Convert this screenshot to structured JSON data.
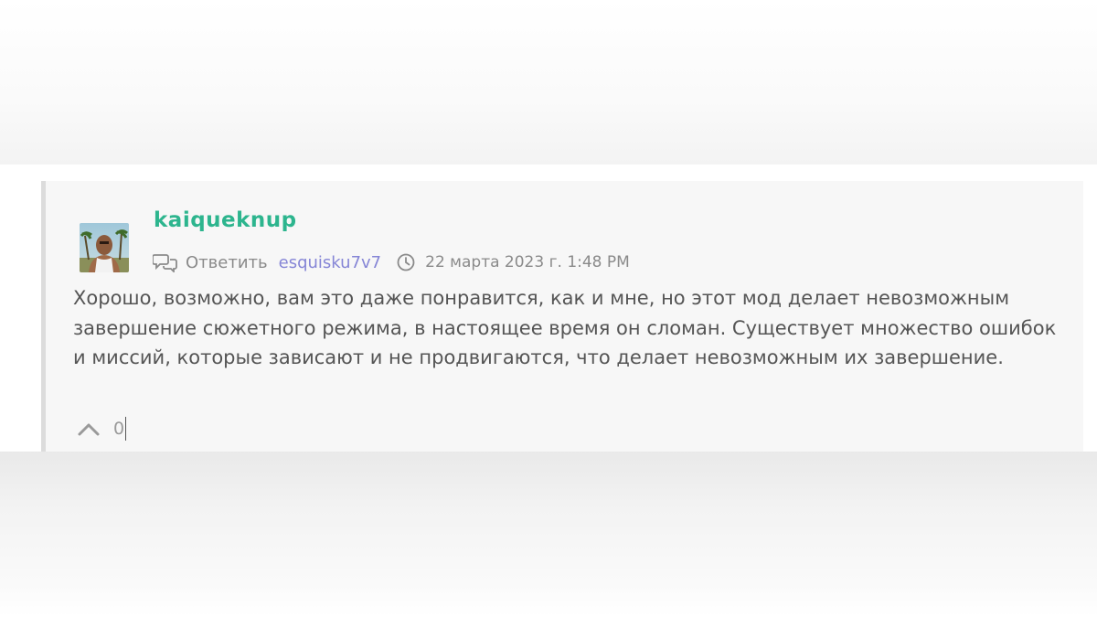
{
  "comment": {
    "author": "kaiqueknup",
    "avatar_icon": "user-avatar",
    "reply_label": "Ответить",
    "reply_to": "esquisku7v7",
    "date": "22 марта 2023 г. 1:48 PM",
    "text": "Хорошо, возможно, вам это даже понравится, как и мне, но этот мод делает невозможным завершение сюжетного режима, в настоящее время он сломан. Существует множество ошибок и миссий, которые зависают и не продвигаются, что делает невозможным их завершение.",
    "votes": "0"
  },
  "icons": {
    "reply": "chat-bubbles-icon",
    "clock": "clock-icon",
    "upvote": "chevron-up-icon"
  },
  "colors": {
    "author": "#2db58e",
    "reply_to": "#8585d6",
    "text": "#555555",
    "muted": "#8a8a8a",
    "card_bg": "#f7f7f7",
    "card_border": "#dcdcdc"
  }
}
